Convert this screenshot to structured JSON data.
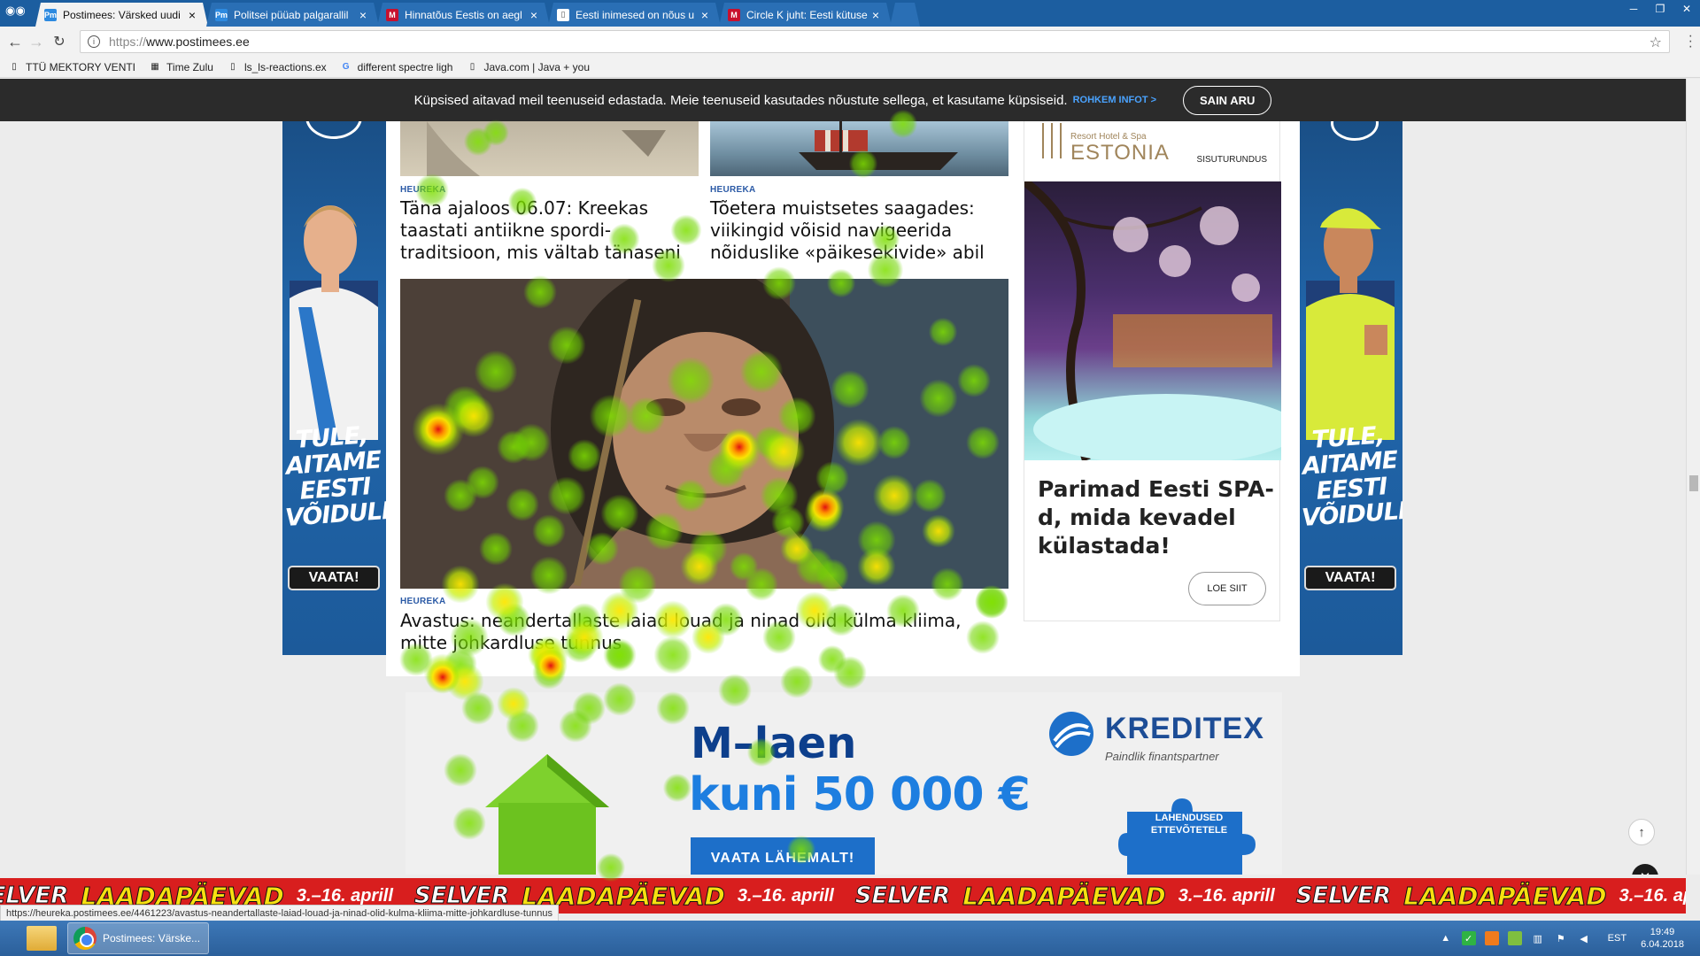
{
  "browser": {
    "tabs": [
      {
        "label": "Postimees: Värsked uudi",
        "favicon": "Pm",
        "favicon_color": "#2d8ae0",
        "active": true
      },
      {
        "label": "Politsei püüab palgarallil",
        "favicon": "Pm",
        "favicon_color": "#2d8ae0",
        "active": false
      },
      {
        "label": "Hinnatõus Eestis on aegl",
        "favicon": "M",
        "favicon_color": "#c8102e",
        "active": false
      },
      {
        "label": "Eesti inimesed on nõus u",
        "favicon": "doc",
        "favicon_color": "#ffffff",
        "active": false
      },
      {
        "label": "Circle K juht: Eesti kütuse",
        "favicon": "M",
        "favicon_color": "#c8102e",
        "active": false
      }
    ],
    "address": {
      "scheme": "https://",
      "host": "www.postimees.ee"
    },
    "bookmarks": [
      {
        "label": "TTÜ MEKTORY VENTI",
        "icon": "page-icon"
      },
      {
        "label": "Time Zulu",
        "icon": "image-icon"
      },
      {
        "label": "ls_ls-reactions.ex",
        "icon": "page-icon"
      },
      {
        "label": "different spectre ligh",
        "icon": "google-icon"
      },
      {
        "label": "Java.com | Java + you",
        "icon": "page-icon"
      }
    ]
  },
  "cookie_banner": {
    "text": "Küpsised aitavad meil teenuseid edastada. Meie teenuseid kasutades nõustute sellega, et kasutame küpsiseid.",
    "more_label": "ROHKEM INFOT >",
    "agree_label": "SAIN ARU"
  },
  "side_ads": {
    "slogan": [
      "TULE,",
      "AITAME",
      "EESTI",
      "VÕIDULE!"
    ],
    "cta": "VAATA!"
  },
  "articles": [
    {
      "category": "HEUREKA",
      "title": "Täna ajaloos 06.07: Kreekas taastati antiikne spordi­traditsioon, mis vältab tänaseni"
    },
    {
      "category": "HEUREKA",
      "title": "Tõetera muistsetes saagades: viikingid võisid navigeerida nõiduslike «päikesekivide» abil"
    },
    {
      "category": "HEUREKA",
      "title": "Avastus: neandertallaste laiad louad ja ninad olid külma kliima, mitte johkardluse tunnus"
    }
  ],
  "sponsor": {
    "logo_small": "Resort Hotel & Spa",
    "logo_big": "ESTONIA",
    "tag": "SISUTURUNDUS",
    "title": "Parimad Eesti SPA-d, mida kevadel külastada!",
    "button": "LOE SIIT"
  },
  "kreditex_ad": {
    "headline": "M–laen",
    "amount": "kuni 50 000 €",
    "button": "VAATA LÄHEMALT!",
    "brand": "KREDITEX",
    "tagline": "Paindlik finantspartner",
    "puzzle_text": "LAHENDUSED ETTEVÕTETELE"
  },
  "selver_banner": {
    "brand": "SELVER",
    "event": "LAADAPÄEVAD",
    "dates": "3.–16. aprill"
  },
  "status_url": "https://heureka.postimees.ee/4461223/avastus-neandertallaste-laiad-louad-ja-ninad-olid-kulma-kliima-mitte-johkardluse-tunnus",
  "taskbar": {
    "app_label": "Postimees: Värske...",
    "language": "EST",
    "time": "19:49",
    "date": "6.04.2018"
  },
  "colors": {
    "tabbar": "#1c5ea0",
    "cookie_bg": "#2b2b2b",
    "category": "#2b5aa6",
    "ad_blue": "#1d4d96",
    "selver_red": "#d81e1e"
  }
}
